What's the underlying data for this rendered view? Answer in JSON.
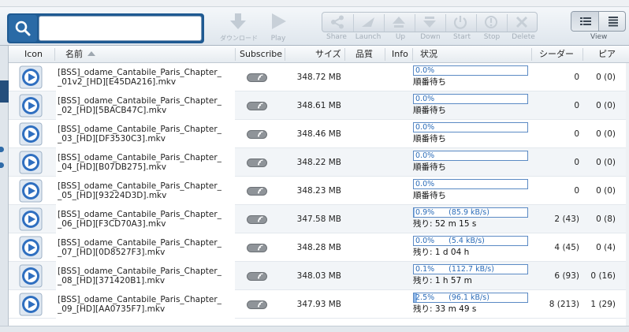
{
  "toolbar": {
    "search": {
      "value": "",
      "placeholder": ""
    },
    "download_label": "ダウンロード",
    "play_label": "Play",
    "actions": [
      {
        "label": "Share",
        "icon": "share-icon"
      },
      {
        "label": "Launch",
        "icon": "launch-icon"
      },
      {
        "label": "Up",
        "icon": "up-icon"
      },
      {
        "label": "Down",
        "icon": "down-icon"
      },
      {
        "label": "Start",
        "icon": "power-icon"
      },
      {
        "label": "Stop",
        "icon": "stop-icon"
      },
      {
        "label": "Delete",
        "icon": "delete-icon"
      }
    ],
    "view_label": "View"
  },
  "columns": {
    "icon": "Icon",
    "name": "名前",
    "subscribe": "Subscribe",
    "size": "サイズ",
    "quality": "品質",
    "info": "Info",
    "status": "状況",
    "seeders": "シーダー",
    "peers": "ピア"
  },
  "rows": [
    {
      "name1": "[BSS]_odame_Cantabile_Paris_Chapter_",
      "name2": "_01v2_[HD][E45DA216].mkv",
      "size": "348.72 MB",
      "progress_text": "0.0%",
      "progress": 0.0,
      "speed": "",
      "status": "順番待ち",
      "seeders": "0",
      "peers": "0 (0)"
    },
    {
      "name1": "[BSS]_odame_Cantabile_Paris_Chapter_",
      "name2": "_02_[HD][5BACB47C].mkv",
      "size": "348.61 MB",
      "progress_text": "0.0%",
      "progress": 0.0,
      "speed": "",
      "status": "順番待ち",
      "seeders": "0",
      "peers": "0 (0)"
    },
    {
      "name1": "[BSS]_odame_Cantabile_Paris_Chapter_",
      "name2": "_03_[HD][DF3530C3].mkv",
      "size": "348.46 MB",
      "progress_text": "0.0%",
      "progress": 0.0,
      "speed": "",
      "status": "順番待ち",
      "seeders": "0",
      "peers": "0 (0)"
    },
    {
      "name1": "[BSS]_odame_Cantabile_Paris_Chapter_",
      "name2": "_04_[HD][B07DB275].mkv",
      "size": "348.22 MB",
      "progress_text": "0.0%",
      "progress": 0.0,
      "speed": "",
      "status": "順番待ち",
      "seeders": "0",
      "peers": "0 (0)"
    },
    {
      "name1": "[BSS]_odame_Cantabile_Paris_Chapter_",
      "name2": "_05_[HD][93224D3D].mkv",
      "size": "348.23 MB",
      "progress_text": "0.0%",
      "progress": 0.0,
      "speed": "",
      "status": "順番待ち",
      "seeders": "0",
      "peers": "0 (0)"
    },
    {
      "name1": "[BSS]_odame_Cantabile_Paris_Chapter_",
      "name2": "_06_[HD][F3CD70A3].mkv",
      "size": "347.58 MB",
      "progress_text": "0.9%",
      "progress": 0.009,
      "speed": "(85.9 kB/s)",
      "status": "残り: 52 m 15 s",
      "seeders": "2 (43)",
      "peers": "0 (8)"
    },
    {
      "name1": "[BSS]_odame_Cantabile_Paris_Chapter_",
      "name2": "_07_[HD][0D8527F3].mkv",
      "size": "348.28 MB",
      "progress_text": "0.0%",
      "progress": 0.0,
      "speed": "(5.4 kB/s)",
      "status": "残り: 1 d 04 h",
      "seeders": "4 (45)",
      "peers": "0 (4)"
    },
    {
      "name1": "[BSS]_odame_Cantabile_Paris_Chapter_",
      "name2": "_08_[HD][371420B1].mkv",
      "size": "348.03 MB",
      "progress_text": "0.1%",
      "progress": 0.001,
      "speed": "(112.7 kB/s)",
      "status": "残り: 1 h 57 m",
      "seeders": "6 (93)",
      "peers": "0 (16)"
    },
    {
      "name1": "[BSS]_odame_Cantabile_Paris_Chapter_",
      "name2": "_09_[HD][AA0735F7].mkv",
      "size": "347.93 MB",
      "progress_text": "2.5%",
      "progress": 0.025,
      "speed": "(96.1 kB/s)",
      "status": "残り: 33 m 49 s",
      "seeders": "8 (213)",
      "peers": "1 (29)"
    }
  ],
  "colors": {
    "progress_border": "#5b8ac4",
    "progress_fill": "#8fb6e6",
    "progress_text": "#2a6bb8",
    "search_bg": "#1f5a92"
  }
}
